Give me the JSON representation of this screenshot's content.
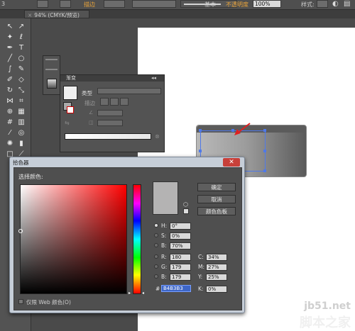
{
  "top_bar": {
    "stroke_label": "描边",
    "stroke_profile": "基本",
    "opacity_label": "不透明度",
    "opacity_value": "100%",
    "style_label": "样式:",
    "partial_left": "3",
    "partial_mid": "描边"
  },
  "document_tab": {
    "close": "×",
    "title": "94% (CMYK/预览)"
  },
  "gradient_panel": {
    "title": "渐变",
    "type_label": "类型",
    "stroke_label": "描边",
    "angle_icon": "angle-icon",
    "aspect_icon": "aspect-icon"
  },
  "color_picker": {
    "title": "拾色器",
    "select_color_label": "选择颜色:",
    "ok_button": "确定",
    "cancel_button": "取消",
    "swatches_button": "颜色色板",
    "hsb": [
      {
        "label": "H:",
        "value": "0°"
      },
      {
        "label": "S:",
        "value": "0%"
      },
      {
        "label": "B:",
        "value": "70%"
      }
    ],
    "rgb": [
      {
        "label": "R:",
        "value": "180"
      },
      {
        "label": "G:",
        "value": "179"
      },
      {
        "label": "B:",
        "value": "179"
      }
    ],
    "cmyk": [
      {
        "label": "C:",
        "value": "34%"
      },
      {
        "label": "M:",
        "value": "27%"
      },
      {
        "label": "Y:",
        "value": "25%"
      },
      {
        "label": "K:",
        "value": "0%"
      }
    ],
    "hex_label": "#",
    "hex_value": "B4B3B3",
    "web_only_label": "仅限 Web 颜色(O)",
    "current_color": "#b4b3b3"
  },
  "watermark": {
    "line1": "jb51.net",
    "line2": "脚本之家"
  },
  "colors": {
    "accent_blue": "#4f79e8",
    "close_red": "#c8403a",
    "arrow_red": "#e02020"
  }
}
